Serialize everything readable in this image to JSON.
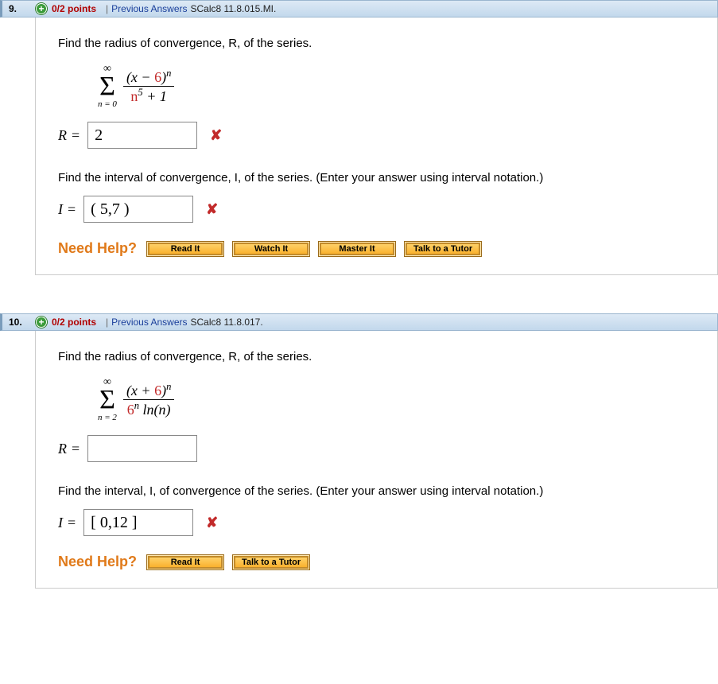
{
  "questions": [
    {
      "number": "9.",
      "points": "0/2 points",
      "previous": "Previous Answers",
      "source": "SCalc8 11.8.015.MI.",
      "prompt1": "Find the radius of convergence, R, of the series.",
      "series": {
        "lower": "n = 0",
        "upper": "∞",
        "num_left": "(x − ",
        "num_const": "6",
        "num_right": ")",
        "num_exp": "n",
        "den_base": "n",
        "den_exp": "5",
        "den_tail": " + 1"
      },
      "r_label": "R",
      "r_value": "2",
      "r_wrong": true,
      "prompt2": "Find the interval of convergence, I, of the series. (Enter your answer using interval notation.)",
      "i_label": "I",
      "i_value": "( 5,7 )",
      "i_wrong": true,
      "help_buttons": [
        "Read It",
        "Watch It",
        "Master It",
        "Talk to a Tutor"
      ]
    },
    {
      "number": "10.",
      "points": "0/2 points",
      "previous": "Previous Answers",
      "source": "SCalc8 11.8.017.",
      "prompt1": "Find the radius of convergence, R, of the series.",
      "series": {
        "lower": "n = 2",
        "upper": "∞",
        "num_left": "(x + ",
        "num_const": "6",
        "num_right": ")",
        "num_exp": "n",
        "den_base": "6",
        "den_exp": "n",
        "den_tail": " ln(n)"
      },
      "r_label": "R",
      "r_value": "",
      "r_wrong": false,
      "prompt2": "Find the interval, I, of convergence of the series. (Enter your answer using interval notation.)",
      "i_label": "I",
      "i_value": "[ 0,12 ]",
      "i_wrong": true,
      "help_buttons": [
        "Read It",
        "Talk to a Tutor"
      ]
    }
  ],
  "need_help_label": "Need Help?",
  "equals": "="
}
